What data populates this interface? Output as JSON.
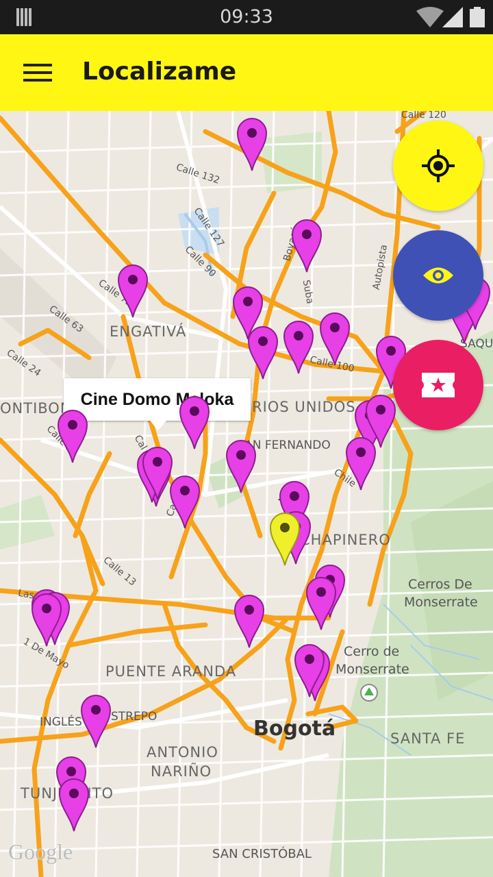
{
  "status_bar": {
    "time": "09:33",
    "icons": [
      "signal-bars-icon",
      "wifi-icon",
      "cell-signal-icon",
      "battery-icon"
    ]
  },
  "app_bar": {
    "title": "Localizame",
    "menu_icon": "hamburger-menu-icon",
    "background": "#fff614"
  },
  "map": {
    "labels": {
      "engativa": "ENGATIVÁ",
      "fontibon": "ONTIBON",
      "barrios_unidos": "RIOS UNIDOS",
      "san_fernando": "SAN FERNANDO",
      "chapinero": "CHAPINERO",
      "puente_aranda": "PUENTE ARANDA",
      "antonio_narino_1": "ANTONIO",
      "antonio_narino_2": "NARIÑO",
      "bogota": "Bogotá",
      "santa_fe": "SANTA FE",
      "san_cristobal": "SAN CRISTÓBAL",
      "tunjuelito": "TUNJUELITO",
      "ingles": "INGLÉS",
      "restrepo": "STREPO",
      "usaquen": "SAQUE",
      "cerros_1": "Cerros De",
      "cerros_2": "Monserrate",
      "cerro_1": "Cerro de",
      "cerro_2": "Monserrate",
      "calle_120": "Calle 120",
      "calle_132": "Calle 132",
      "calle_127": "Calle 127",
      "calle_90": "Calle 90",
      "calle_72": "Calle 72",
      "calle_63": "Calle 63",
      "calle_24": "Calle 24",
      "calle_22": "Calle 22",
      "calle_100": "Calle 100",
      "calle_13": "Calle 13",
      "boyaca": "Boyacá",
      "suba": "Suba",
      "autopista": "Autopista",
      "nqs": "Nqs",
      "chile": "Chile",
      "las_americas": "Las Am",
      "primero_mayo": "1 De Mayo",
      "cal": "Cal",
      "car": "Car"
    },
    "google_logo": "Google"
  },
  "info_window": {
    "title": "Cine Domo Maloka"
  },
  "markers": {
    "pin_color": "#e640e6",
    "selected_color": "#f0f02a",
    "count_magenta": 36,
    "count_yellow": 1
  },
  "fabs": {
    "location": {
      "icon": "my-location-crosshair-icon",
      "color": "#fff614"
    },
    "visibility": {
      "icon": "eye-icon",
      "color": "#3f51b5"
    },
    "tickets": {
      "icon": "ticket-star-icon",
      "color": "#ea1e63"
    }
  }
}
